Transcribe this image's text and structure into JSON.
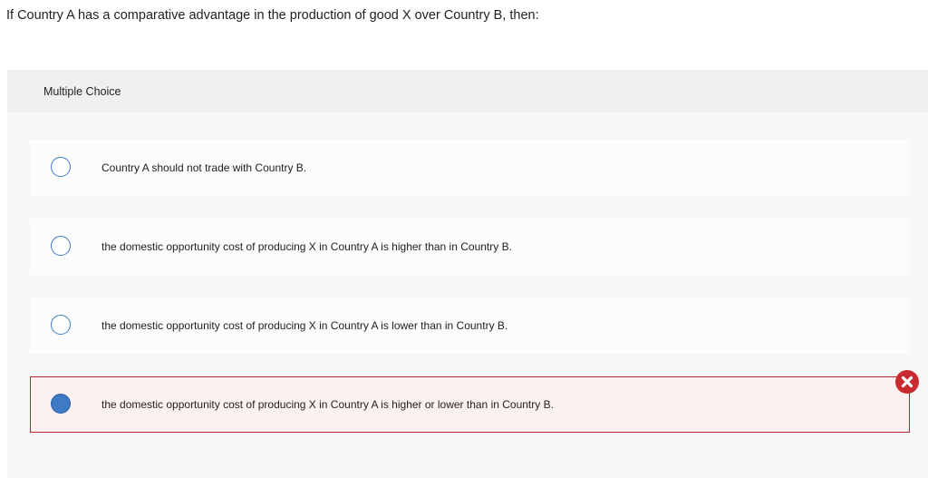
{
  "question": {
    "text": "If Country A has a comparative advantage in the production of good X over Country B, then:"
  },
  "panel": {
    "type_label": "Multiple Choice"
  },
  "options": [
    {
      "text": "Country A should not trade with Country B.",
      "selected": false,
      "status": ""
    },
    {
      "text": "the domestic opportunity cost of producing X in Country A is higher than in Country B.",
      "selected": false,
      "status": ""
    },
    {
      "text": "the domestic opportunity cost of producing X in Country A is lower than in Country B.",
      "selected": false,
      "status": ""
    },
    {
      "text": "the domestic opportunity cost of producing X in Country A is higher or lower than in Country B.",
      "selected": true,
      "status": "incorrect"
    }
  ],
  "feedback": {
    "icon": "incorrect-x-icon"
  },
  "colors": {
    "radio_border": "#3e7bc4",
    "radio_selected_fill": "#3e7bc4",
    "incorrect_border": "#b4282e",
    "incorrect_background": "#fcf0f0",
    "incorrect_badge": "#c92a30",
    "panel_background": "#f7f7f7",
    "panel_header_background": "#f0f0f0"
  }
}
